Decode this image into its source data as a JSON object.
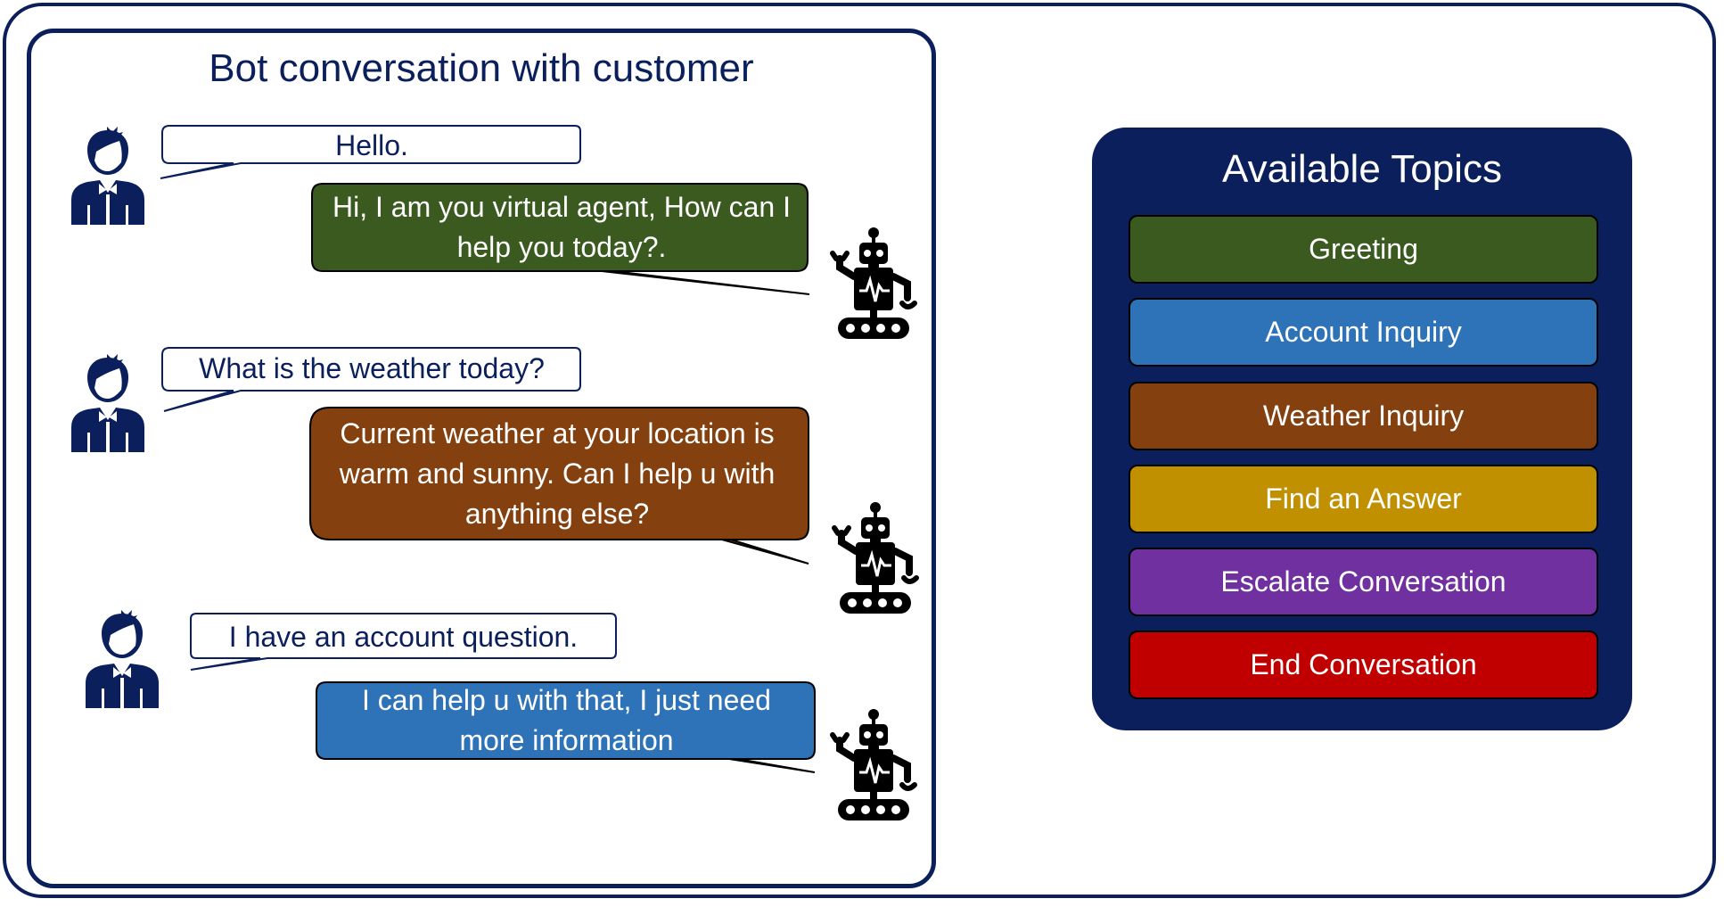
{
  "conversation": {
    "title": "Bot conversation with customer",
    "messages": [
      {
        "speaker": "user",
        "text": "Hello."
      },
      {
        "speaker": "bot",
        "text": "Hi, I am you virtual agent, How can I help you today?.",
        "color": "#3a5a20"
      },
      {
        "speaker": "user",
        "text": "What is the weather today?"
      },
      {
        "speaker": "bot",
        "text": "Current weather at your location is warm and sunny.  Can I help u with anything else?",
        "color": "#84400f"
      },
      {
        "speaker": "user",
        "text": "I have an account question."
      },
      {
        "speaker": "bot",
        "text": "I can help u with that, I just need more information",
        "color": "#2e72b8"
      }
    ],
    "icons": {
      "user": "person-icon",
      "bot": "robot-icon"
    }
  },
  "topics": {
    "title": "Available Topics",
    "items": [
      {
        "label": "Greeting",
        "color": "#3a5a20"
      },
      {
        "label": "Account Inquiry",
        "color": "#2e72b8"
      },
      {
        "label": "Weather Inquiry",
        "color": "#84400f"
      },
      {
        "label": "Find an Answer",
        "color": "#c09000"
      },
      {
        "label": "Escalate Conversation",
        "color": "#7030a0"
      },
      {
        "label": "End Conversation",
        "color": "#c00000"
      }
    ]
  },
  "colors": {
    "navy": "#0a1f5c"
  }
}
